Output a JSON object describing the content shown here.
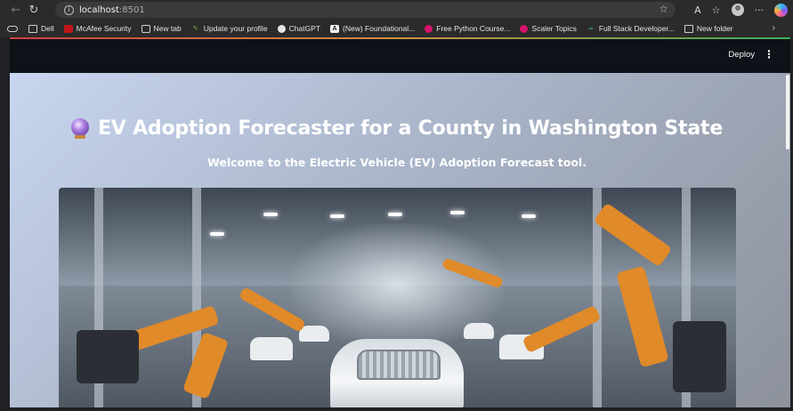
{
  "browser": {
    "url_host": "localhost",
    "url_port": ":8501",
    "bookmarks": [
      {
        "label": "Dell",
        "icon": "folder-icon"
      },
      {
        "label": "McAfee Security",
        "icon": "mcafee-icon"
      },
      {
        "label": "New tab",
        "icon": "tab-icon"
      },
      {
        "label": "Update your profile",
        "icon": "leaf-icon"
      },
      {
        "label": "ChatGPT",
        "icon": "chatgpt-icon"
      },
      {
        "label": "(New) Foundational...",
        "icon": "anthropic-icon"
      },
      {
        "label": "Free Python Course...",
        "icon": "scaler-icon"
      },
      {
        "label": "Scaler Topics",
        "icon": "scaler-icon"
      },
      {
        "label": "Full Stack Developer...",
        "icon": "fsd-icon"
      },
      {
        "label": "New folder",
        "icon": "folder-icon"
      }
    ]
  },
  "app_header": {
    "deploy_label": "Deploy",
    "menu_icon": "⋮"
  },
  "main": {
    "title": "EV Adoption Forecaster for a County in Washington State",
    "subtitle": "Welcome to the Electric Vehicle (EV) Adoption Forecast tool.",
    "hero_image": "factory-robots-image"
  },
  "colors": {
    "header_bg": "#0e1117",
    "main_bg_start": "#c8d6f0",
    "main_bg_end": "#8d929b",
    "robot_arm": "#e08a2a"
  }
}
